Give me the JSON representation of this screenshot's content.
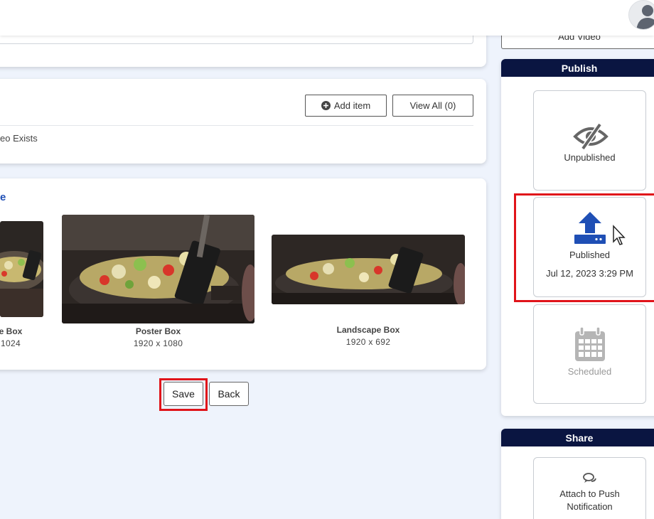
{
  "header": {
    "avatar_icon": "user-avatar-icon"
  },
  "sidebar_top": {
    "add_video_label": "Add Video"
  },
  "related": {
    "add_item_label": "Add item",
    "view_all_label": "View All (0)",
    "empty_text": "eo Exists"
  },
  "images": {
    "section_title_fragment": "e",
    "items": [
      {
        "title": "e Box",
        "size": "1024"
      },
      {
        "title": "Poster Box",
        "size": "1920 x 1080"
      },
      {
        "title": "Landscape Box",
        "size": "1920 x 692"
      }
    ]
  },
  "actions": {
    "save_label": "Save",
    "back_label": "Back"
  },
  "publish": {
    "header": "Publish",
    "unpublished_label": "Unpublished",
    "published_label": "Published",
    "published_date": "Jul 12, 2023 3:29 PM",
    "scheduled_label": "Scheduled",
    "accent_color": "#1f4fb5",
    "highlight_color": "#e0141a"
  },
  "share": {
    "header": "Share",
    "push_label_line1": "Attach to Push",
    "push_label_line2": "Notification"
  }
}
